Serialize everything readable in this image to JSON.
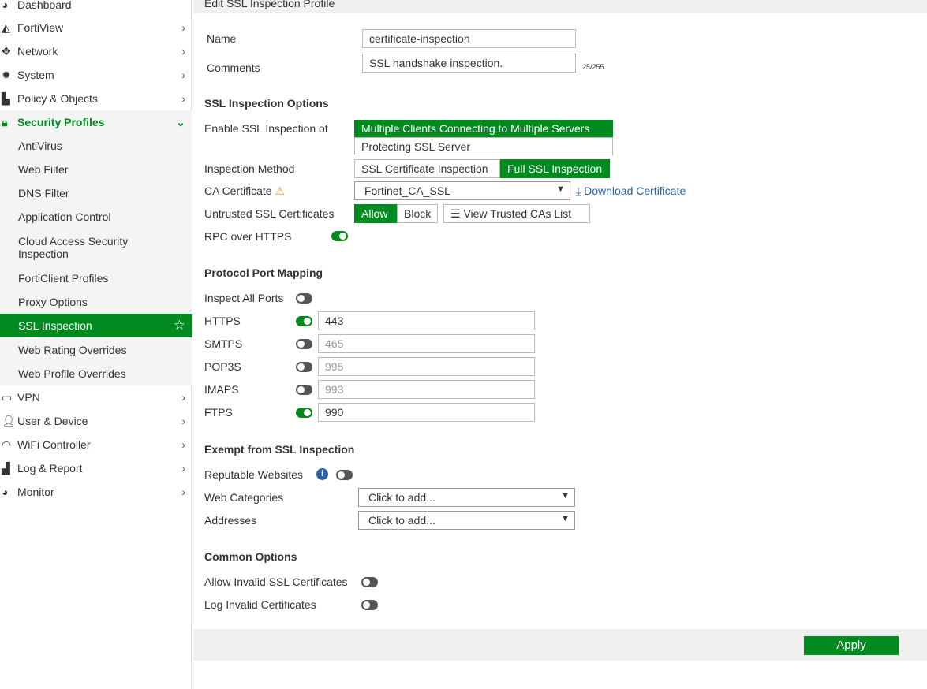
{
  "sidebar": {
    "items": [
      {
        "label": "Dashboard",
        "icon": "dashboard-icon"
      },
      {
        "label": "FortiView",
        "icon": "fortiview-icon"
      },
      {
        "label": "Network",
        "icon": "network-icon"
      },
      {
        "label": "System",
        "icon": "gear-icon"
      },
      {
        "label": "Policy & Objects",
        "icon": "policy-icon"
      },
      {
        "label": "Security Profiles",
        "icon": "lock-icon"
      },
      {
        "label": "AntiVirus"
      },
      {
        "label": "Web Filter"
      },
      {
        "label": "DNS Filter"
      },
      {
        "label": "Application Control"
      },
      {
        "label": "Cloud Access Security",
        "label2": "Inspection"
      },
      {
        "label": "FortiClient Profiles"
      },
      {
        "label": "Proxy Options"
      },
      {
        "label": "SSL Inspection"
      },
      {
        "label": "Web Rating Overrides"
      },
      {
        "label": "Web Profile Overrides"
      },
      {
        "label": "VPN"
      },
      {
        "label": "User & Device"
      },
      {
        "label": "WiFi Controller"
      },
      {
        "label": "Log & Report"
      },
      {
        "label": "Monitor"
      }
    ]
  },
  "header": {
    "title": "Edit SSL Inspection Profile"
  },
  "form": {
    "name_label": "Name",
    "name_value": "certificate-inspection",
    "comments_label": "Comments",
    "comments_value": "SSL handshake inspection.",
    "comments_count": "25/255",
    "ssl_options_title": "SSL Inspection Options",
    "enable_label": "Enable SSL Inspection of",
    "enable_opt1": "Multiple Clients Connecting to Multiple Servers",
    "enable_opt2": "Protecting SSL Server",
    "method_label": "Inspection Method",
    "method_opt1": "SSL Certificate Inspection",
    "method_opt2": "Full SSL Inspection",
    "ca_label": "CA Certificate",
    "ca_value": "Fortinet_CA_SSL",
    "download": "Download Certificate",
    "untrusted_label": "Untrusted SSL Certificates",
    "allow": "Allow",
    "block": "Block",
    "view_cas": "View Trusted CAs List",
    "rpc_label": "RPC over HTTPS",
    "rpc_on": true,
    "port_title": "Protocol Port Mapping",
    "inspect_all": "Inspect All Ports",
    "ports": [
      {
        "label": "HTTPS",
        "value": "443",
        "on": true
      },
      {
        "label": "SMTPS",
        "value": "465",
        "on": false
      },
      {
        "label": "POP3S",
        "value": "995",
        "on": false
      },
      {
        "label": "IMAPS",
        "value": "993",
        "on": false
      },
      {
        "label": "FTPS",
        "value": "990",
        "on": true
      }
    ],
    "exempt_title": "Exempt from SSL Inspection",
    "reputable": "Reputable Websites",
    "web_cat": "Web Categories",
    "addresses": "Addresses",
    "click_add": "Click to add...",
    "common_title": "Common Options",
    "allow_invalid": "Allow Invalid SSL Certificates",
    "log_invalid": "Log Invalid Certificates"
  },
  "footer": {
    "apply": "Apply"
  },
  "colors": {
    "accent": "#008a20"
  }
}
